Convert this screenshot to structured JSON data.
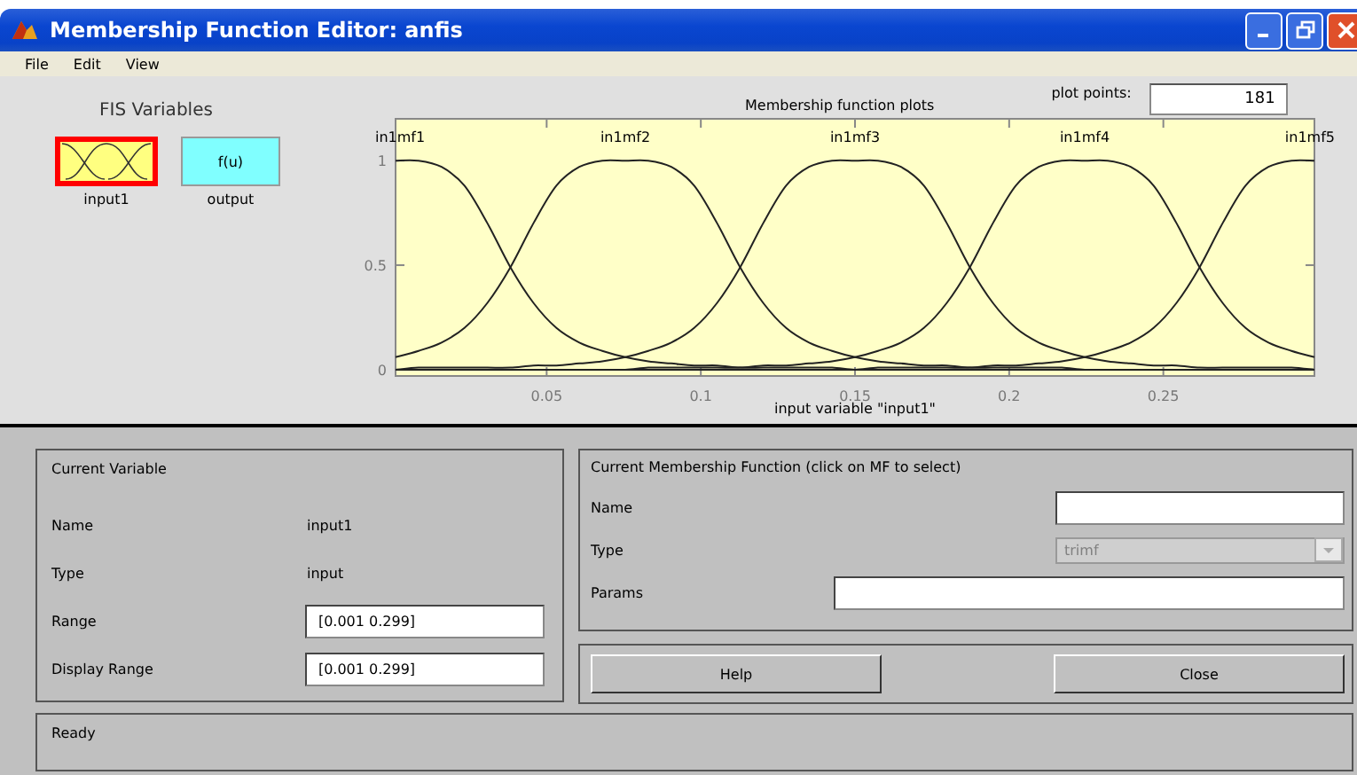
{
  "window": {
    "title": "Membership Function Editor: anfis"
  },
  "menu": [
    "File",
    "Edit",
    "View"
  ],
  "fis_variables": {
    "title": "FIS Variables",
    "items": [
      {
        "label": "input1",
        "kind": "input",
        "selected": true
      },
      {
        "label": "output",
        "kind": "output",
        "box_text": "f(u)",
        "selected": false
      }
    ]
  },
  "plot": {
    "plot_points_label": "plot points:",
    "plot_points": "181",
    "chart_data": {
      "type": "line",
      "title": "Membership function plots",
      "xlabel": "input variable \"input1\"",
      "xlim": [
        0.001,
        0.299
      ],
      "ylim": [
        -0.03,
        1.2
      ],
      "xticks": [
        0.05,
        0.1,
        0.15,
        0.2,
        0.25
      ],
      "yticks": [
        0,
        0.5,
        1
      ],
      "x": [
        0.001,
        0.00845,
        0.0159,
        0.02335,
        0.0308,
        0.03825,
        0.0457,
        0.05315,
        0.0606,
        0.06805,
        0.0755,
        0.08295,
        0.0904,
        0.09785,
        0.1053,
        0.11275,
        0.1202,
        0.12765,
        0.1351,
        0.14255,
        0.15,
        0.15745,
        0.1649,
        0.17235,
        0.1798,
        0.18725,
        0.1947,
        0.20215,
        0.2096,
        0.21705,
        0.2245,
        0.23195,
        0.2394,
        0.24685,
        0.2543,
        0.26175,
        0.2692,
        0.27665,
        0.2841,
        0.29155,
        0.299
      ],
      "series": [
        {
          "name": "in1mf1",
          "values": [
            1,
            1,
            0.97,
            0.88,
            0.7,
            0.49,
            0.32,
            0.2,
            0.13,
            0.09,
            0.06,
            0.04,
            0.03,
            0.02,
            0.02,
            0.01,
            0.01,
            0.01,
            0.01,
            0.01,
            0,
            0,
            0,
            0,
            0,
            0,
            0,
            0,
            0,
            0,
            0,
            0,
            0,
            0,
            0,
            0,
            0,
            0,
            0,
            0,
            0
          ]
        },
        {
          "name": "in1mf2",
          "values": [
            0.06,
            0.09,
            0.13,
            0.2,
            0.32,
            0.49,
            0.7,
            0.88,
            0.97,
            1,
            1,
            1,
            0.97,
            0.88,
            0.7,
            0.49,
            0.32,
            0.2,
            0.13,
            0.09,
            0.06,
            0.04,
            0.03,
            0.02,
            0.02,
            0.01,
            0.01,
            0.01,
            0.01,
            0.01,
            0,
            0,
            0,
            0,
            0,
            0,
            0,
            0,
            0,
            0,
            0
          ]
        },
        {
          "name": "in1mf3",
          "values": [
            0,
            0.01,
            0.01,
            0.01,
            0.01,
            0.01,
            0.02,
            0.02,
            0.03,
            0.04,
            0.06,
            0.09,
            0.13,
            0.2,
            0.32,
            0.49,
            0.7,
            0.88,
            0.97,
            1,
            1,
            1,
            0.97,
            0.88,
            0.7,
            0.49,
            0.32,
            0.2,
            0.13,
            0.09,
            0.06,
            0.04,
            0.03,
            0.02,
            0.02,
            0.01,
            0.01,
            0.01,
            0.01,
            0.01,
            0
          ]
        },
        {
          "name": "in1mf4",
          "values": [
            0,
            0,
            0,
            0,
            0,
            0,
            0,
            0,
            0,
            0,
            0,
            0.01,
            0.01,
            0.01,
            0.01,
            0.01,
            0.02,
            0.02,
            0.03,
            0.04,
            0.06,
            0.09,
            0.13,
            0.2,
            0.32,
            0.49,
            0.7,
            0.88,
            0.97,
            1,
            1,
            1,
            0.97,
            0.88,
            0.7,
            0.49,
            0.32,
            0.2,
            0.13,
            0.09,
            0.06
          ]
        },
        {
          "name": "in1mf5",
          "values": [
            0,
            0,
            0,
            0,
            0,
            0,
            0,
            0,
            0,
            0,
            0,
            0,
            0,
            0,
            0,
            0,
            0,
            0,
            0,
            0,
            0,
            0.01,
            0.01,
            0.01,
            0.01,
            0.01,
            0.02,
            0.02,
            0.03,
            0.04,
            0.06,
            0.09,
            0.13,
            0.2,
            0.32,
            0.49,
            0.7,
            0.88,
            0.97,
            1,
            1
          ]
        }
      ]
    }
  },
  "current_variable": {
    "title": "Current Variable",
    "name_label": "Name",
    "name": "input1",
    "type_label": "Type",
    "type": "input",
    "range_label": "Range",
    "range": "[0.001 0.299]",
    "display_range_label": "Display Range",
    "display_range": "[0.001 0.299]"
  },
  "current_mf": {
    "title": "Current Membership Function (click on MF to select)",
    "name_label": "Name",
    "type_label": "Type",
    "type": "trimf",
    "type_disabled": true,
    "params_label": "Params"
  },
  "buttons": [
    "Help",
    "Close"
  ],
  "status": "Ready"
}
